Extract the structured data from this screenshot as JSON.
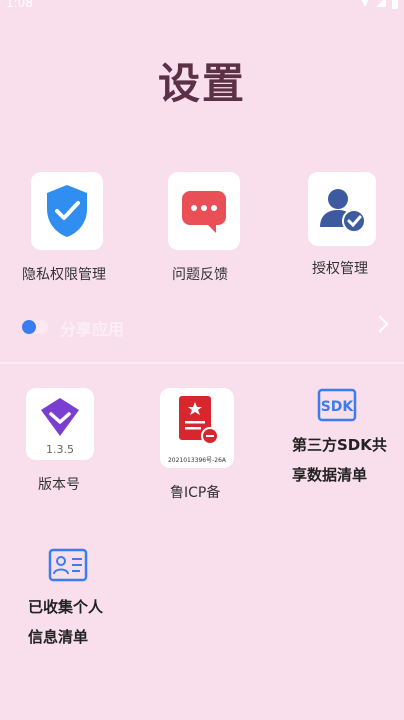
{
  "status_bar": {
    "time": "1:08"
  },
  "page_title": "设置",
  "top_grid": [
    {
      "label": "隐私权限管理",
      "icon": "shield-check-icon"
    },
    {
      "label": "问题反馈",
      "icon": "chat-bubble-icon"
    },
    {
      "label": "授权管理",
      "icon": "user-check-icon"
    }
  ],
  "share_row": {
    "label": "分享应用"
  },
  "version": {
    "number": "1.3.5",
    "label": "版本号"
  },
  "icp": {
    "small_text": "2021013396号-26A",
    "label": "鲁ICP备"
  },
  "sdk": {
    "badge": "SDK",
    "line1": "第三方SDK共",
    "line2": "享数据清单"
  },
  "personal_info": {
    "line1": "已收集个人",
    "line2": "信息清单"
  },
  "colors": {
    "background": "#f9dfeb",
    "title": "#5c3145",
    "accent_blue": "#3b7df0",
    "accent_red": "#e94c55",
    "accent_purple": "#7a3fd1"
  }
}
